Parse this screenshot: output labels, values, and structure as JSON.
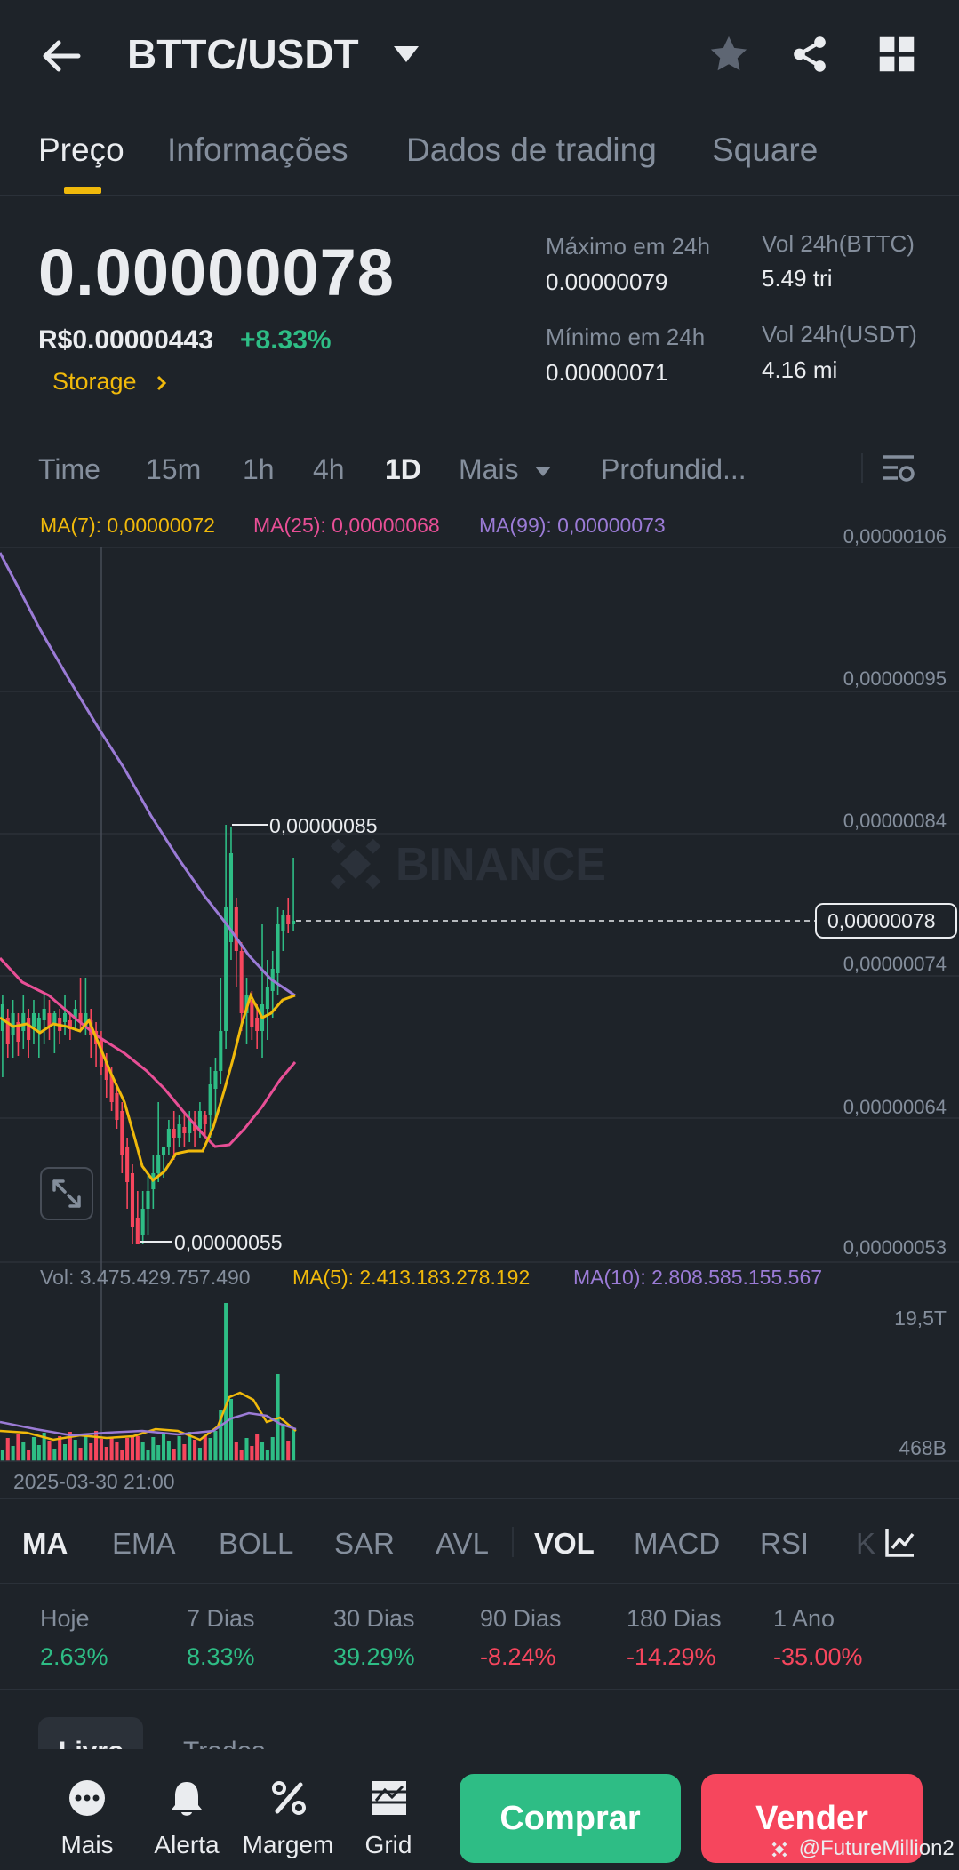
{
  "header": {
    "pair": "BTTC/USDT",
    "tabs": [
      "Preço",
      "Informações",
      "Dados de trading",
      "Square"
    ]
  },
  "price": {
    "last": "0.00000078",
    "fiat": "R$0.00000443",
    "change": "+8.33%",
    "tag": "Storage",
    "high_label": "Máximo em 24h",
    "high_value": "0.00000079",
    "low_label": "Mínimo em 24h",
    "low_value": "0.00000071",
    "vol_base_label": "Vol 24h(BTTC)",
    "vol_base_value": "5.49 tri",
    "vol_quote_label": "Vol 24h(USDT)",
    "vol_quote_value": "4.16 mi"
  },
  "intervals": [
    "Time",
    "15m",
    "1h",
    "4h",
    "1D",
    "Mais",
    "Profundid..."
  ],
  "chart": {
    "ma7": "MA(7): 0,00000072",
    "ma25": "MA(25): 0,00000068",
    "ma99": "MA(99): 0,00000073",
    "price_axis": [
      "0,00000106",
      "0,00000095",
      "0,00000084",
      "0,00000074",
      "0,00000064",
      "0,00000053"
    ],
    "current_price_label": "0,00000078",
    "high_marker": "0,00000085",
    "low_marker": "0,00000055",
    "watermark": "BINANCE",
    "vol_legend": "Vol: 3.475.429.757.490",
    "vol_ma5": "MA(5): 2.413.183.278.192",
    "vol_ma10": "MA(10): 2.808.585.155.567",
    "vol_axis_top": "19,5T",
    "vol_axis_bottom": "468B",
    "crosshair_time": "2025-03-30 21:00"
  },
  "indicators": [
    "MA",
    "EMA",
    "BOLL",
    "SAR",
    "AVL",
    "VOL",
    "MACD",
    "RSI",
    "K"
  ],
  "performance": [
    {
      "label": "Hoje",
      "value": "2.63%",
      "dir": "up"
    },
    {
      "label": "7 Dias",
      "value": "8.33%",
      "dir": "up"
    },
    {
      "label": "30 Dias",
      "value": "39.29%",
      "dir": "up"
    },
    {
      "label": "90 Dias",
      "value": "-8.24%",
      "dir": "down"
    },
    {
      "label": "180 Dias",
      "value": "-14.29%",
      "dir": "down"
    },
    {
      "label": "1 Ano",
      "value": "-35.00%",
      "dir": "down"
    }
  ],
  "book_tabs": [
    "Livro",
    "Trades"
  ],
  "bottom_nav": {
    "mais": "Mais",
    "alerta": "Alerta",
    "margem": "Margem",
    "grid": "Grid",
    "buy": "Comprar",
    "sell": "Vender",
    "watermark_user": "@FutureMillion2"
  },
  "colors": {
    "background": "#1E2329",
    "up": "#2EBD85",
    "down": "#F6465D",
    "accent": "#F0B90B",
    "ma25": "#E84F96",
    "ma99": "#9B7BD6"
  },
  "icons": [
    "back-arrow-icon",
    "caret-down-icon",
    "star-icon",
    "share-icon",
    "grid-icon",
    "chevron-right-icon",
    "chart-settings-icon",
    "expand-icon",
    "indicator-settings-icon",
    "more-dots-icon",
    "bell-icon",
    "percent-icon",
    "grid-bot-icon",
    "binance-logo-icon"
  ]
}
